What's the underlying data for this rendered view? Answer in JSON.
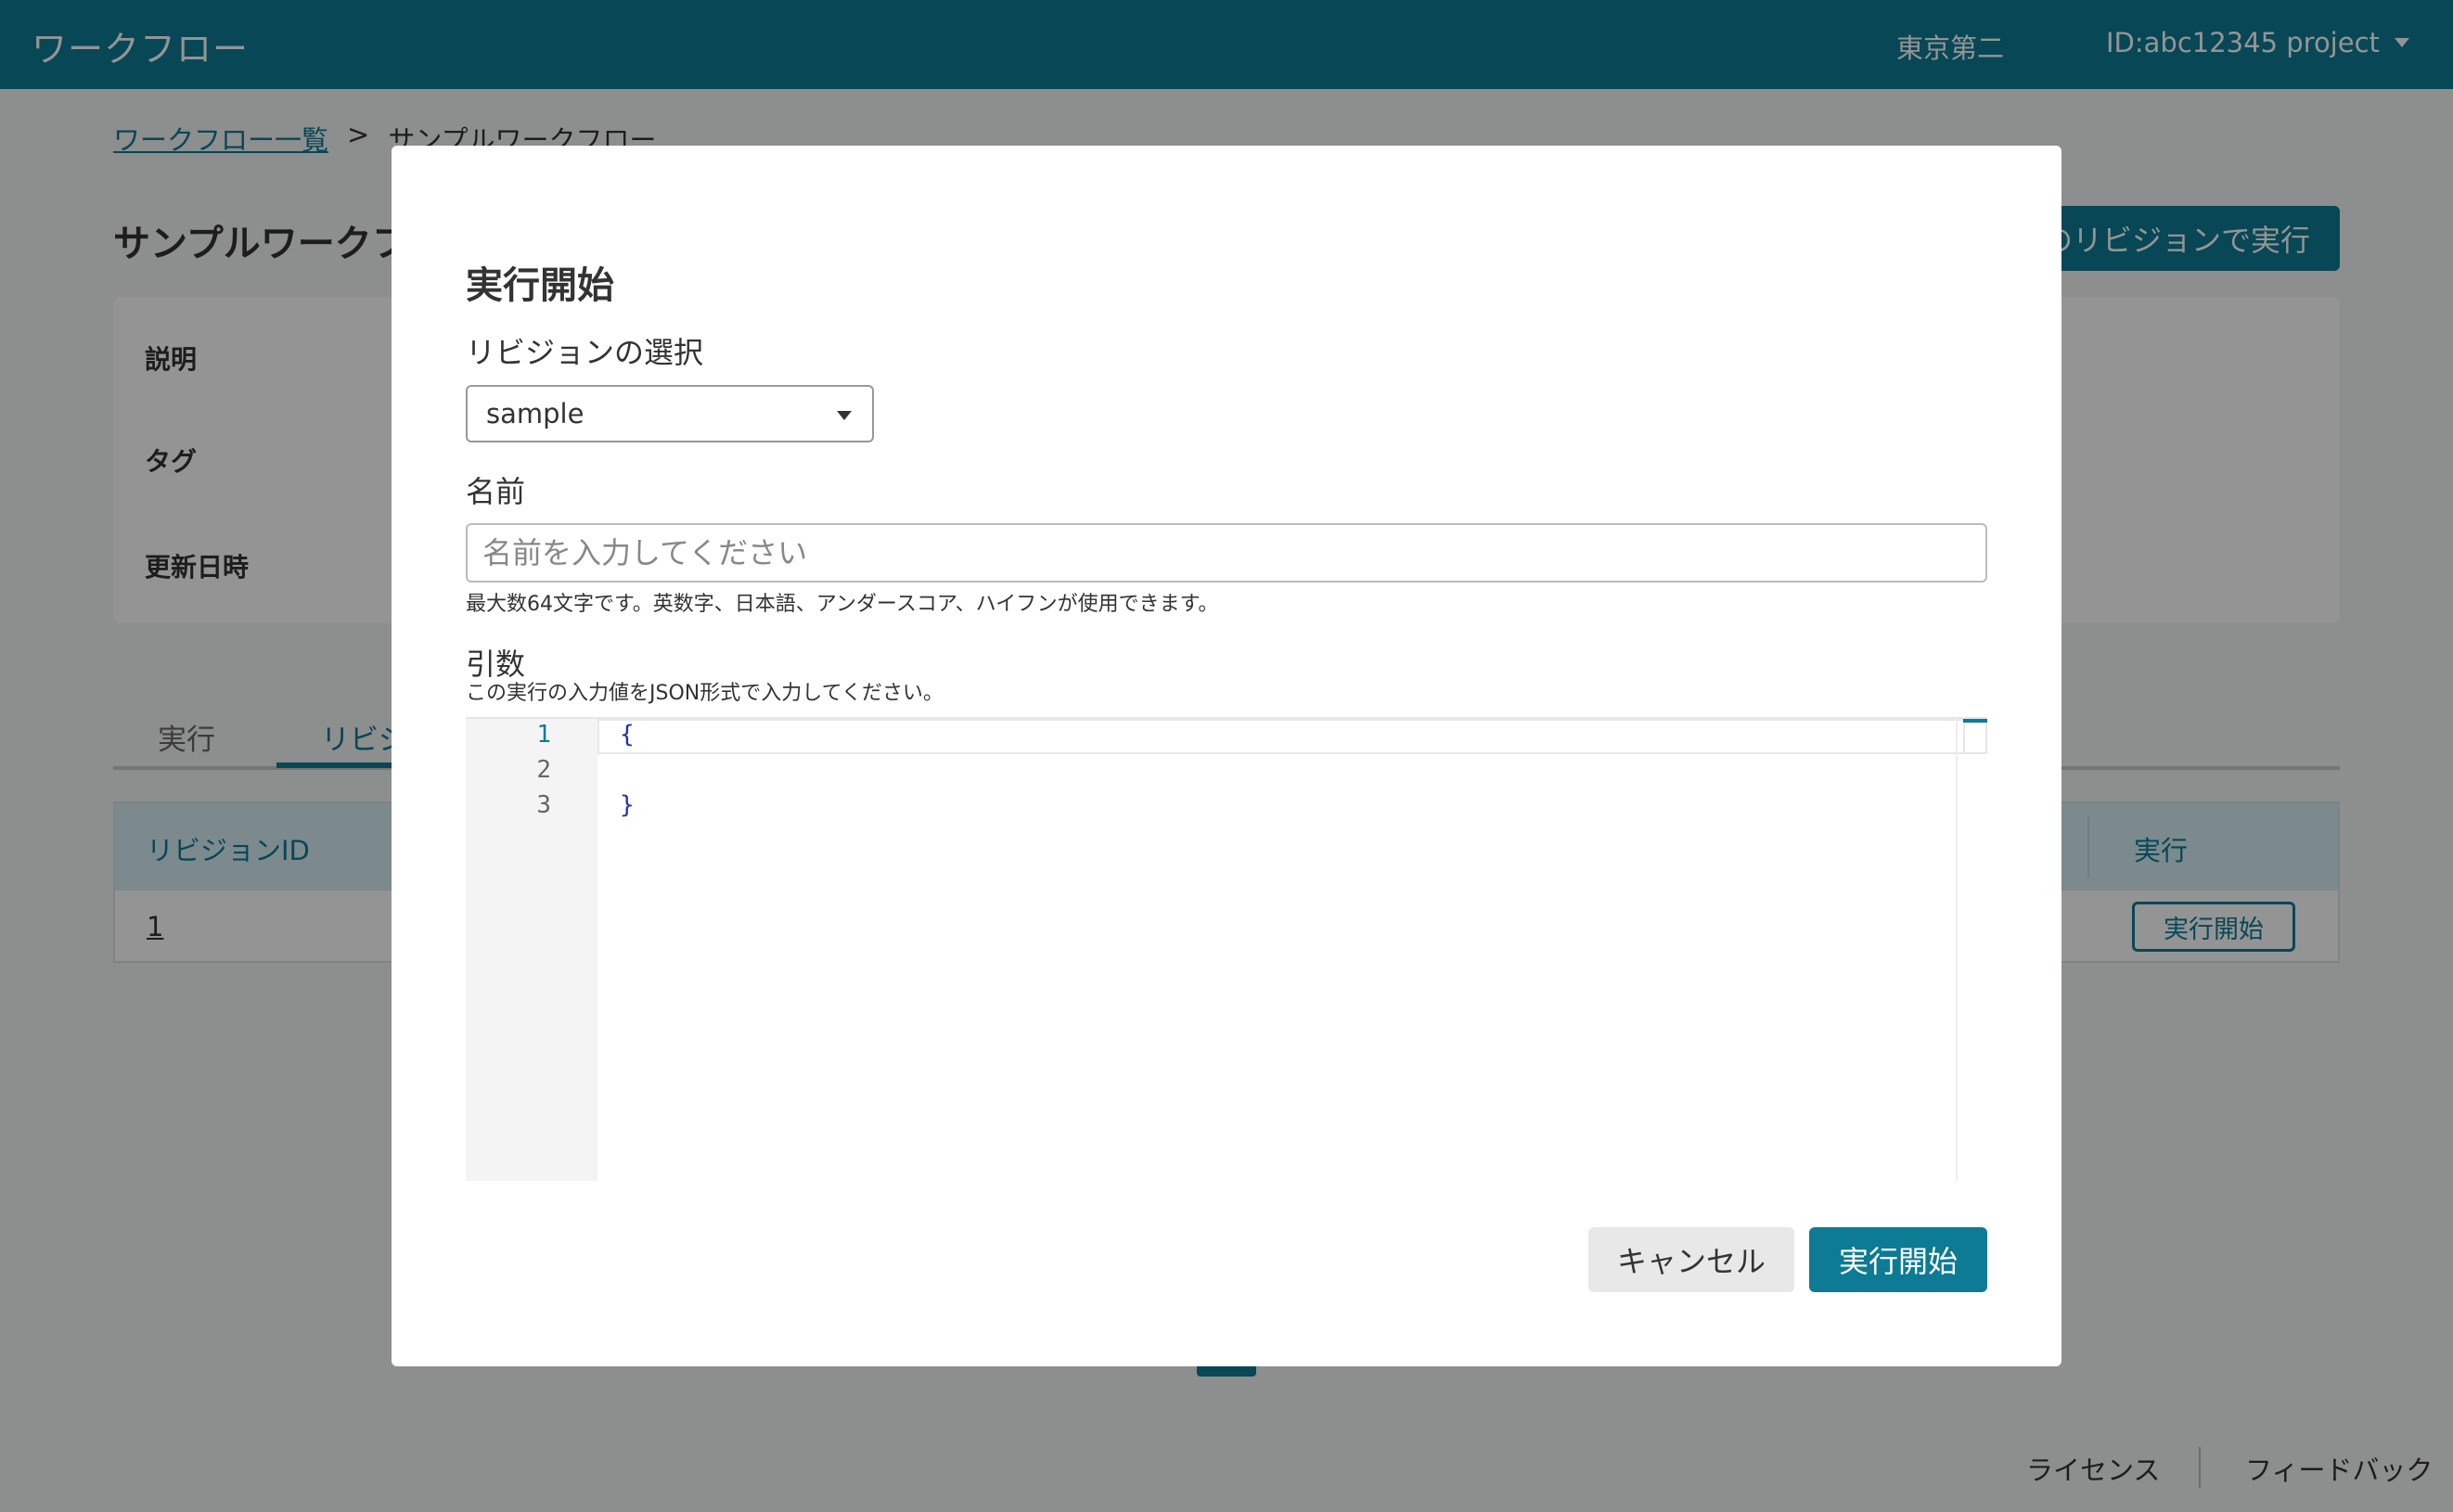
{
  "header": {
    "app_title": "ワークフロー",
    "region": "東京第二",
    "project": "ID:abc12345 project"
  },
  "breadcrumb": {
    "parent": "ワークフロー一覧",
    "separator": ">",
    "current": "サンプルワークフロー"
  },
  "page": {
    "title": "サンプルワークフ",
    "run_revision_button": "のリビジョンで実行"
  },
  "info": {
    "labels": [
      "説明",
      "タグ",
      "更新日時"
    ]
  },
  "tabs": [
    {
      "label": "実行"
    },
    {
      "label": "リビジ"
    }
  ],
  "table": {
    "headers": [
      "リビジョンID",
      "実行"
    ],
    "rows": [
      {
        "revision_id": "1",
        "action": "実行開始"
      }
    ]
  },
  "footer": {
    "license": "ライセンス",
    "feedback": "フィードバック"
  },
  "modal": {
    "title": "実行開始",
    "revision_label": "リビジョンの選択",
    "revision_selected": "sample",
    "name_label": "名前",
    "name_value": "",
    "name_placeholder": "名前を入力してください",
    "name_hint": "最大数64文字です。英数字、日本語、アンダースコア、ハイフンが使用できます。",
    "args_label": "引数",
    "args_hint": "この実行の入力値をJSON形式で入力してください。",
    "editor": {
      "line_numbers": [
        "1",
        "2",
        "3"
      ],
      "lines": [
        "{",
        "",
        "}"
      ]
    },
    "cancel_button": "キャンセル",
    "start_button": "実行開始"
  },
  "colors": {
    "brand": "#0d7b94",
    "overlay": "rgba(0,0,0,0.42)"
  }
}
